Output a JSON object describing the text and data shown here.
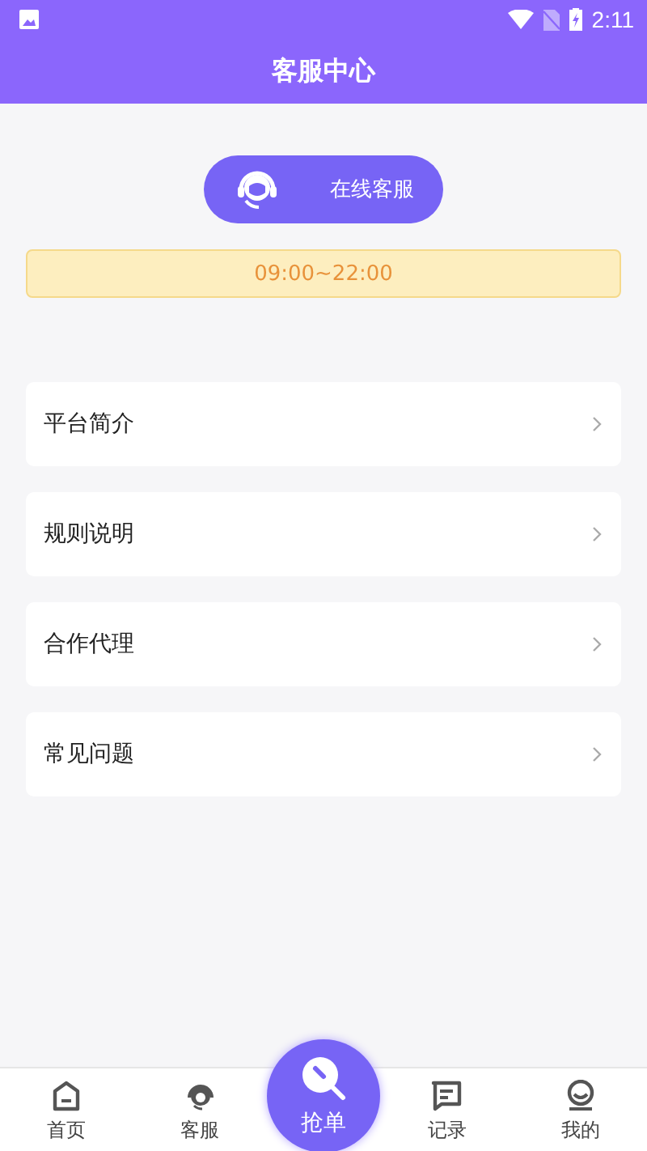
{
  "status_bar": {
    "time": "2:11"
  },
  "header": {
    "title": "客服中心"
  },
  "online_service": {
    "label": "在线客服"
  },
  "hours": "09:00~22:00",
  "menu": [
    {
      "label": "平台简介"
    },
    {
      "label": "规则说明"
    },
    {
      "label": "合作代理"
    },
    {
      "label": "常见问题"
    }
  ],
  "tabs": [
    {
      "label": "首页",
      "kind": "home"
    },
    {
      "label": "客服",
      "kind": "service"
    },
    {
      "label": "抢单",
      "kind": "center"
    },
    {
      "label": "记录",
      "kind": "record"
    },
    {
      "label": "我的",
      "kind": "profile"
    }
  ]
}
